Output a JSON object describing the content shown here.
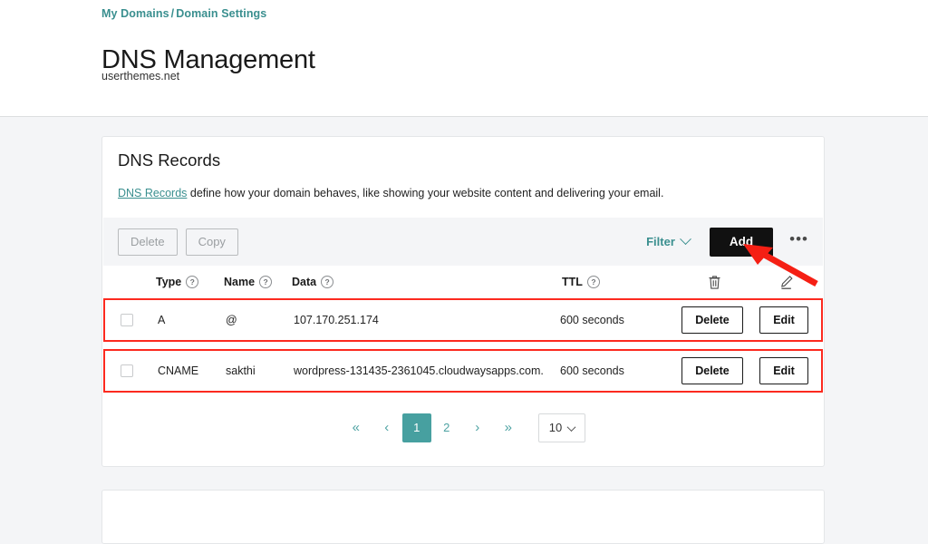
{
  "header": {
    "breadcrumb": {
      "items": [
        "My Domains",
        "Domain Settings"
      ],
      "separator": "/"
    },
    "title": "DNS Management",
    "subtitle": "userthemes.net"
  },
  "card": {
    "title": "DNS Records",
    "description_link": "DNS Records",
    "description_rest": " define how your domain behaves, like showing your website content and delivering your email."
  },
  "toolbar": {
    "delete_label": "Delete",
    "copy_label": "Copy",
    "filter_label": "Filter",
    "filter_icon": "chevron-down-icon",
    "add_label": "Add",
    "more_label": "•••",
    "more_icon": "ellipsis-icon"
  },
  "table": {
    "columns": [
      {
        "key": "select",
        "label": "",
        "icon": "checkbox-icon"
      },
      {
        "key": "type",
        "label": "Type",
        "help": "?"
      },
      {
        "key": "name",
        "label": "Name",
        "help": "?"
      },
      {
        "key": "data",
        "label": "Data",
        "help": "?"
      },
      {
        "key": "ttl",
        "label": "TTL",
        "help": "?"
      },
      {
        "key": "delete",
        "label": "",
        "icon": "trash-icon"
      },
      {
        "key": "edit",
        "label": "",
        "icon": "pencil-icon"
      }
    ],
    "rows": [
      {
        "type": "A",
        "name": "@",
        "data": "107.170.251.174",
        "ttl": "600 seconds",
        "delete_label": "Delete",
        "edit_label": "Edit",
        "highlighted": true
      },
      {
        "type": "CNAME",
        "name": "sakthi",
        "data": "wordpress-131435-2361045.cloudwaysapps.com.",
        "ttl": "600 seconds",
        "delete_label": "Delete",
        "edit_label": "Edit",
        "highlighted": true
      }
    ]
  },
  "pagination": {
    "first": "«",
    "prev": "‹",
    "pages": [
      "1",
      "2"
    ],
    "active_page": "1",
    "next": "›",
    "last": "»",
    "per_page": "10",
    "per_page_icon": "chevron-down-icon"
  },
  "annotation": {
    "arrow_color": "#f51f14",
    "arrow_target": "add-button"
  },
  "colors": {
    "accent_teal": "#3a8f8f",
    "pagination_active": "#47a0a0",
    "add_button_bg": "#111111",
    "highlight_red": "#fc2a1f",
    "page_bg": "#f4f5f7",
    "card_bg": "#ffffff"
  }
}
